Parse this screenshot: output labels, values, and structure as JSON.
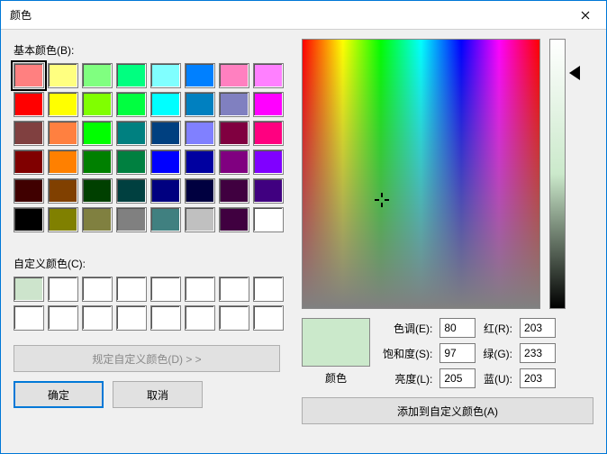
{
  "title": "颜色",
  "labels": {
    "basic_colors": "基本颜色(B):",
    "custom_colors": "自定义颜色(C):",
    "define_custom": "规定自定义颜色(D) > >",
    "ok": "确定",
    "cancel": "取消",
    "hue": "色调(E):",
    "sat": "饱和度(S):",
    "lum": "亮度(L):",
    "red": "红(R):",
    "green": "绿(G):",
    "blue": "蓝(U):",
    "color_preview": "颜色",
    "add_custom": "添加到自定义颜色(A)"
  },
  "basic_colors": [
    "#ff8080",
    "#ffff80",
    "#80ff80",
    "#00ff80",
    "#80ffff",
    "#0080ff",
    "#ff80c0",
    "#ff80ff",
    "#ff0000",
    "#ffff00",
    "#80ff00",
    "#00ff40",
    "#00ffff",
    "#0080c0",
    "#8080c0",
    "#ff00ff",
    "#804040",
    "#ff8040",
    "#00ff00",
    "#008080",
    "#004080",
    "#8080ff",
    "#800040",
    "#ff0080",
    "#800000",
    "#ff8000",
    "#008000",
    "#008040",
    "#0000ff",
    "#0000a0",
    "#800080",
    "#8000ff",
    "#400000",
    "#804000",
    "#004000",
    "#004040",
    "#000080",
    "#000040",
    "#400040",
    "#400080",
    "#000000",
    "#808000",
    "#808040",
    "#808080",
    "#408080",
    "#c0c0c0",
    "#400040",
    "#ffffff"
  ],
  "selected_basic_index": 0,
  "custom_colors_count": 16,
  "custom_selected_index": 0,
  "values": {
    "hue": "80",
    "sat": "97",
    "lum": "205",
    "red": "203",
    "green": "233",
    "blue": "203"
  },
  "preview_color": "#cbe9cb"
}
